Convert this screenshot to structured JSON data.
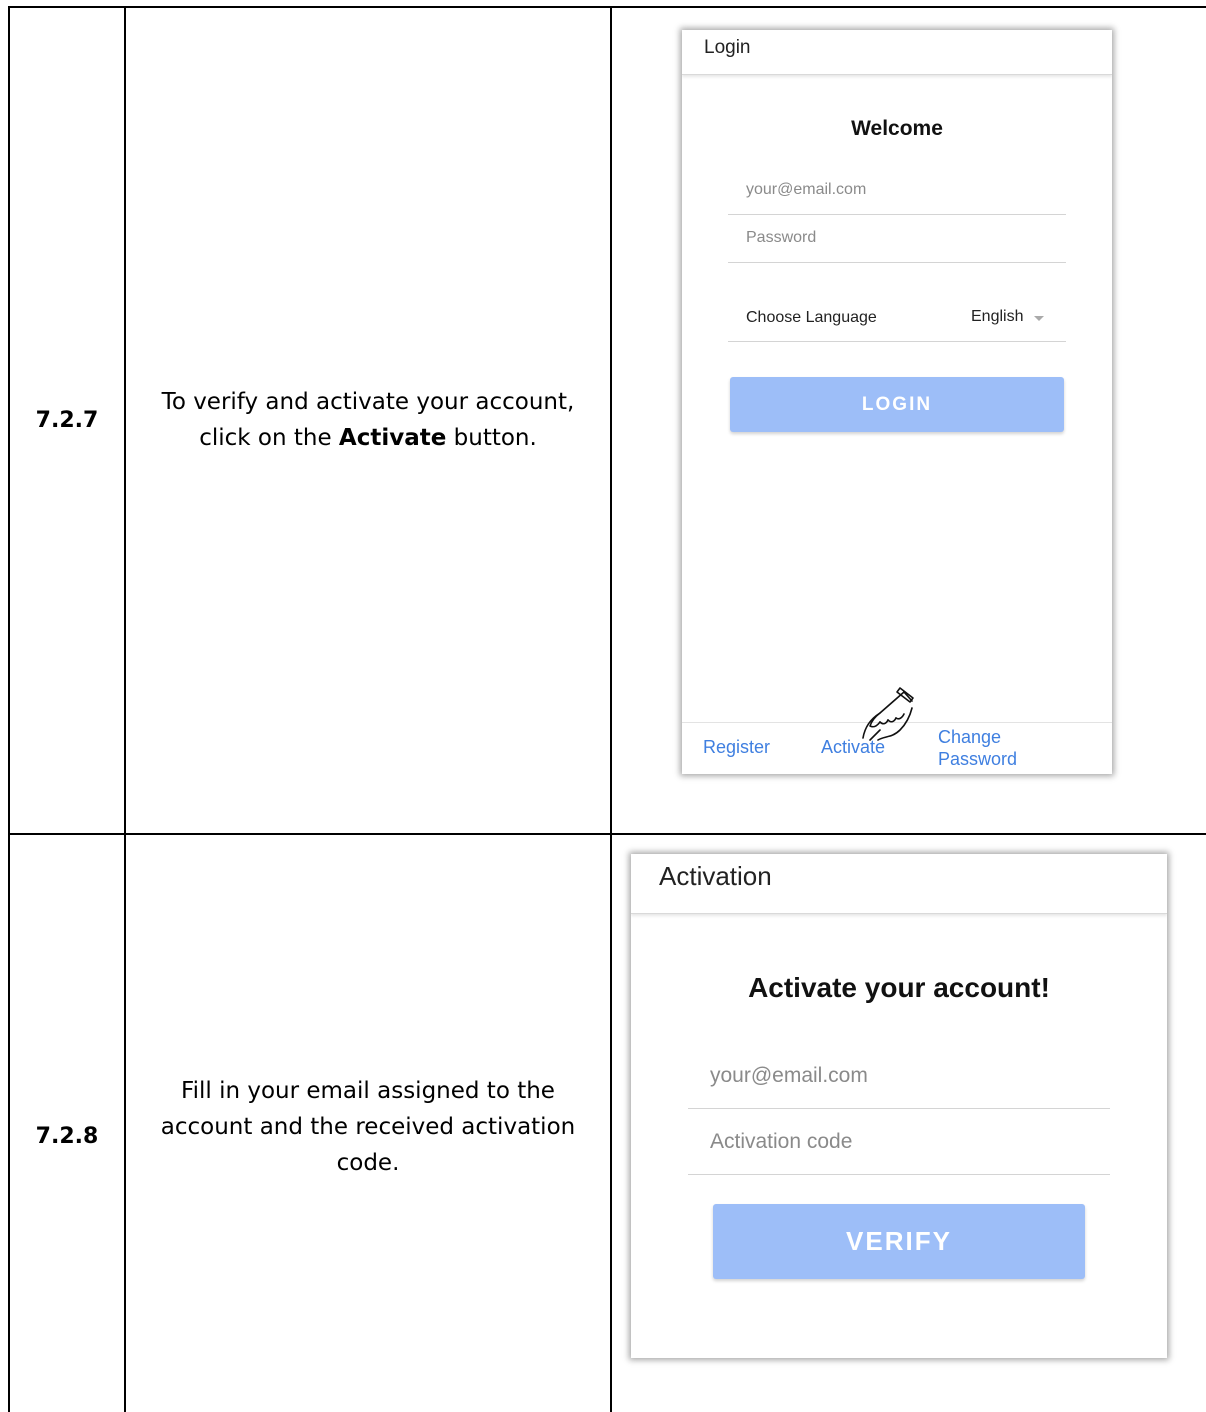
{
  "rows": [
    {
      "step": "7.2.7",
      "instruction_prefix": "To verify and activate your account,",
      "instruction_pre_bold": "click on the ",
      "instruction_bold": "Activate",
      "instruction_post_bold": " button."
    },
    {
      "step": "7.2.8",
      "instruction_line1": "Fill in your email assigned to the",
      "instruction_line2": "account and the received activation",
      "instruction_line3": "code."
    }
  ],
  "login_screen": {
    "title": "Login",
    "welcome": "Welcome",
    "email_placeholder": "your@email.com",
    "password_placeholder": "Password",
    "language_label": "Choose Language",
    "language_value": "English",
    "login_button": "LOGIN",
    "footer_links": {
      "register": "Register",
      "activate": "Activate",
      "change_password_line1": "Change",
      "change_password_line2": "Password"
    },
    "button_color": "#9dbef8",
    "link_color": "#3f7fe0"
  },
  "activation_screen": {
    "title": "Activation",
    "heading": "Activate your account!",
    "email_placeholder": "your@email.com",
    "code_placeholder": "Activation code",
    "verify_button": "VERIFY"
  },
  "icons": {
    "pointer": "pointing-hand-icon",
    "dropdown": "caret-down-icon"
  }
}
